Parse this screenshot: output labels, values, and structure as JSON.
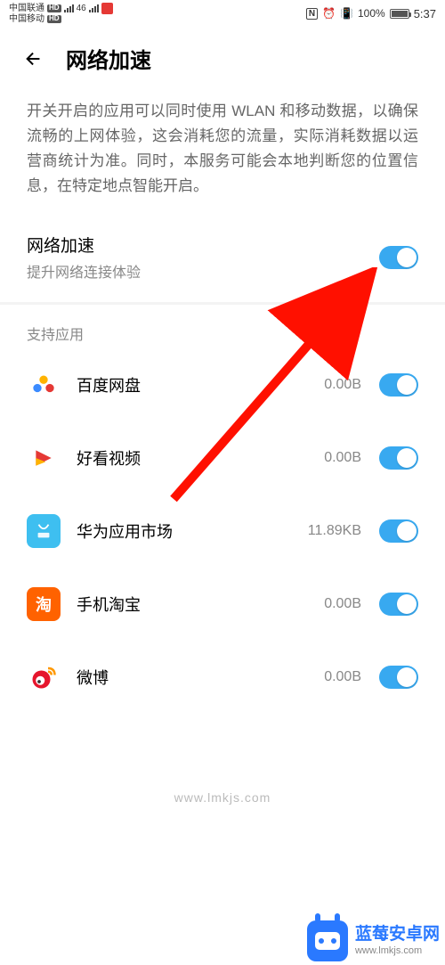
{
  "status_bar": {
    "carrier1": "中国联通",
    "carrier2": "中国移动",
    "network": "46",
    "battery_pct": "100%",
    "time": "5:37"
  },
  "header": {
    "title": "网络加速"
  },
  "description": "开关开启的应用可以同时使用 WLAN 和移动数据，以确保流畅的上网体验，这会消耗您的流量，实际消耗数据以运营商统计为准。同时，本服务可能会本地判断您的位置信息，在特定地点智能开启。",
  "main_toggle": {
    "title": "网络加速",
    "subtitle": "提升网络连接体验",
    "enabled": true
  },
  "section_title": "支持应用",
  "apps": [
    {
      "name": "百度网盘",
      "data": "0.00B",
      "enabled": true,
      "icon_id": "baidu-netdisk"
    },
    {
      "name": "好看视频",
      "data": "0.00B",
      "enabled": true,
      "icon_id": "haokan"
    },
    {
      "name": "华为应用市场",
      "data": "11.89KB",
      "enabled": true,
      "icon_id": "huawei-appgallery"
    },
    {
      "name": "手机淘宝",
      "data": "0.00B",
      "enabled": true,
      "icon_id": "taobao"
    },
    {
      "name": "微博",
      "data": "0.00B",
      "enabled": true,
      "icon_id": "weibo"
    }
  ],
  "watermark": "www.lmkjs.com",
  "footer": {
    "brand": "蓝莓安卓网",
    "url": "www.lmkjs.com"
  },
  "icon_colors": {
    "baidu-netdisk": "#ffffff",
    "haokan": "#ffffff",
    "huawei-appgallery": "#3ebff0",
    "taobao": "#ff6200",
    "weibo": "#ffffff"
  }
}
